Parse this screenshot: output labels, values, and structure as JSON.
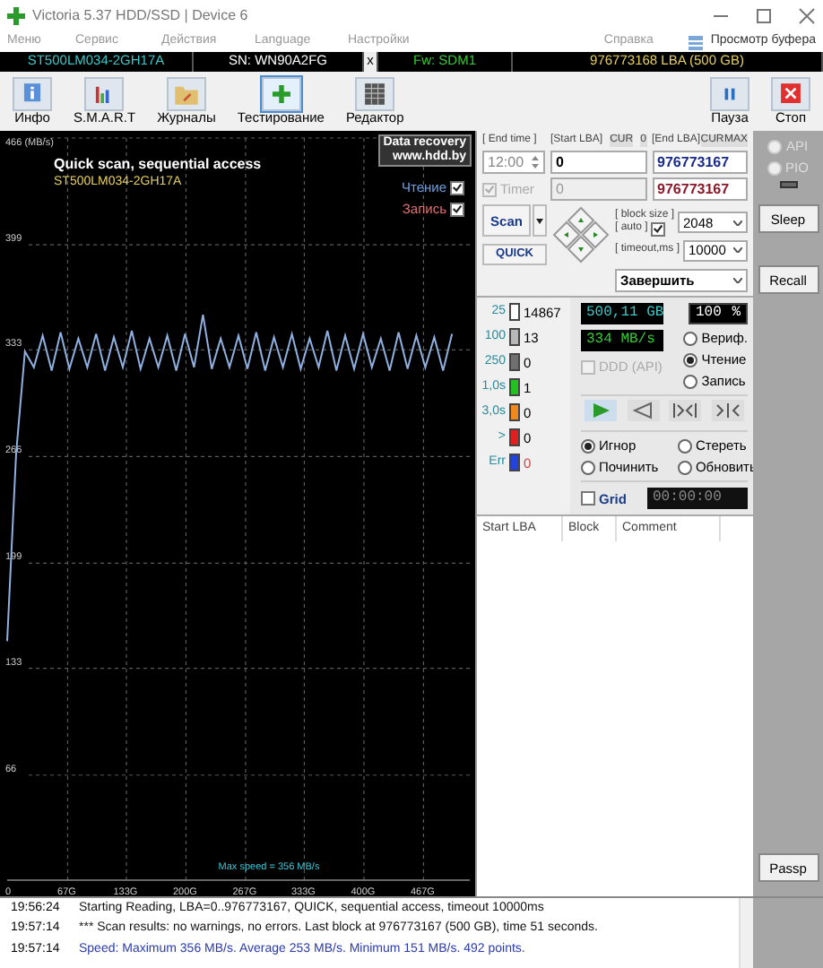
{
  "window": {
    "title": "Victoria 5.37 HDD/SSD | Device 6"
  },
  "menu": [
    "Меню",
    "Сервис",
    "Действия",
    "Language",
    "Настройки",
    "Справка"
  ],
  "buffer_view": "Просмотр буфера",
  "drive_bar": {
    "model": "ST500LM034-2GH17A",
    "serial": "SN: WN90A2FG",
    "close": "x",
    "firmware": "Fw: SDM1",
    "capacity": "976773168 LBA (500 GB)"
  },
  "toolbar": [
    {
      "label": "Инфо",
      "kind": "info",
      "selected": false
    },
    {
      "label": "S.M.A.R.T",
      "kind": "smart",
      "selected": false
    },
    {
      "label": "Журналы",
      "kind": "logs",
      "selected": false
    },
    {
      "label": "Тестирование",
      "kind": "test",
      "selected": true
    },
    {
      "label": "Редактор",
      "kind": "editor",
      "selected": false
    }
  ],
  "toolbar_right": [
    {
      "label": "Пауза",
      "kind": "pause"
    },
    {
      "label": "Стоп",
      "kind": "stop"
    }
  ],
  "graph": {
    "title": "Quick scan, sequential access",
    "model": "ST500LM034-2GH17A",
    "badge": [
      "Data recovery",
      "www.hdd.by"
    ],
    "toggles": [
      {
        "label": "Чтение",
        "checked": true
      },
      {
        "label": "Запись",
        "checked": true
      }
    ],
    "max_speed": "Max speed = 356 MB/s",
    "chart_data": {
      "type": "line",
      "grid": true,
      "ylabel": "466 (MB/s)",
      "xlim": [
        0,
        520
      ],
      "ylim": [
        0,
        466
      ],
      "xticks": [
        {
          "value": 0,
          "label": "0"
        },
        {
          "value": 67,
          "label": "67G"
        },
        {
          "value": 133,
          "label": "133G"
        },
        {
          "value": 200,
          "label": "200G"
        },
        {
          "value": 267,
          "label": "267G"
        },
        {
          "value": 333,
          "label": "333G"
        },
        {
          "value": 400,
          "label": "400G"
        },
        {
          "value": 467,
          "label": "467G"
        }
      ],
      "yticks": [
        66,
        133,
        199,
        266,
        333,
        399
      ],
      "x": [
        0,
        10,
        20,
        30,
        40,
        50,
        60,
        70,
        80,
        90,
        100,
        110,
        120,
        130,
        140,
        150,
        160,
        170,
        180,
        190,
        200,
        210,
        220,
        230,
        240,
        250,
        260,
        270,
        280,
        290,
        300,
        310,
        320,
        330,
        340,
        350,
        360,
        370,
        380,
        390,
        400,
        410,
        420,
        430,
        440,
        450,
        460,
        470,
        480,
        490,
        500
      ],
      "series": [
        {
          "color": "#8fb0e0",
          "values": [
            150,
            268,
            332,
            322,
            342,
            320,
            344,
            321,
            340,
            322,
            343,
            320,
            341,
            322,
            345,
            321,
            340,
            322,
            342,
            320,
            343,
            322,
            355,
            321,
            340,
            322,
            342,
            321,
            344,
            320,
            341,
            322,
            343,
            321,
            340,
            322,
            345,
            320,
            342,
            321,
            343,
            322,
            340,
            320,
            344,
            321,
            342,
            322,
            341,
            320,
            343
          ]
        }
      ]
    }
  },
  "scan": {
    "end_time_label": "[ End time ]",
    "end_time": "12:00",
    "start_lba_label": "[Start LBA]",
    "start_cur": "CUR",
    "start_zero": "0",
    "end_lba_label": "[End LBA]",
    "end_cur": "CUR",
    "end_max": "MAX",
    "start_lba": "0",
    "end_lba": "976773167",
    "timer": {
      "label": "Timer",
      "checked": true,
      "disabled": true
    },
    "timer_value": "0",
    "end_lba_2": "976773167",
    "scan_button": "Scan",
    "quick_button": "QUICK",
    "block_size_label": "[ block size ]",
    "auto_label": "[ auto ]",
    "auto_checked": true,
    "block_size": "2048",
    "timeout_label": "[ timeout,ms ]",
    "timeout": "10000",
    "finish": "Завершить"
  },
  "legend": [
    {
      "label": "25",
      "count": "14867",
      "color": "#ffffff"
    },
    {
      "label": "100",
      "count": "13",
      "color": "#b8b8b8"
    },
    {
      "label": "250",
      "count": "0",
      "color": "#707070"
    },
    {
      "label": "1,0s",
      "count": "1",
      "color": "#22c022"
    },
    {
      "label": "3,0s",
      "count": "0",
      "color": "#f08820"
    },
    {
      "label": ">",
      "count": "0",
      "color": "#e02020"
    },
    {
      "label": "Err",
      "count": "0",
      "color": "#2244dd"
    }
  ],
  "status": {
    "size": "500,11 GB",
    "percent": "100",
    "percent_unit": "%",
    "speed": "334 MB/s",
    "ddd": {
      "label": "DDD (API)",
      "checked": false,
      "disabled": true
    }
  },
  "mode": [
    {
      "label": "Вериф.",
      "selected": false
    },
    {
      "label": "Чтение",
      "selected": true
    },
    {
      "label": "Запись",
      "selected": false
    }
  ],
  "action": [
    {
      "label": "Игнор",
      "selected": true
    },
    {
      "label": "Стереть",
      "selected": false
    },
    {
      "label": "Починить",
      "selected": false
    },
    {
      "label": "Обновить",
      "selected": false
    }
  ],
  "grid": {
    "label": "Grid",
    "checked": false,
    "clock": "00:00:00"
  },
  "table": {
    "columns": [
      "Start LBA",
      "Block",
      "Comment"
    ]
  },
  "side": {
    "interfaces": [
      {
        "label": "API",
        "selected": false,
        "disabled": true
      },
      {
        "label": "PIO",
        "selected": false,
        "disabled": true
      }
    ],
    "buttons": [
      "Sleep",
      "Recall"
    ],
    "passp": "Passp"
  },
  "log": [
    {
      "time": "19:56:24",
      "text": "Starting Reading, LBA=0..976773167, QUICK, sequential access, timeout 10000ms",
      "kind": "info"
    },
    {
      "time": "19:57:14",
      "text": "*** Scan results: no warnings, no errors. Last block at 976773167 (500 GB), time 51 seconds.",
      "kind": "info"
    },
    {
      "time": "19:57:14",
      "text": "Speed: Maximum 356 MB/s. Average 253 MB/s. Minimum 151 MB/s. 492 points.",
      "kind": "speed"
    }
  ]
}
